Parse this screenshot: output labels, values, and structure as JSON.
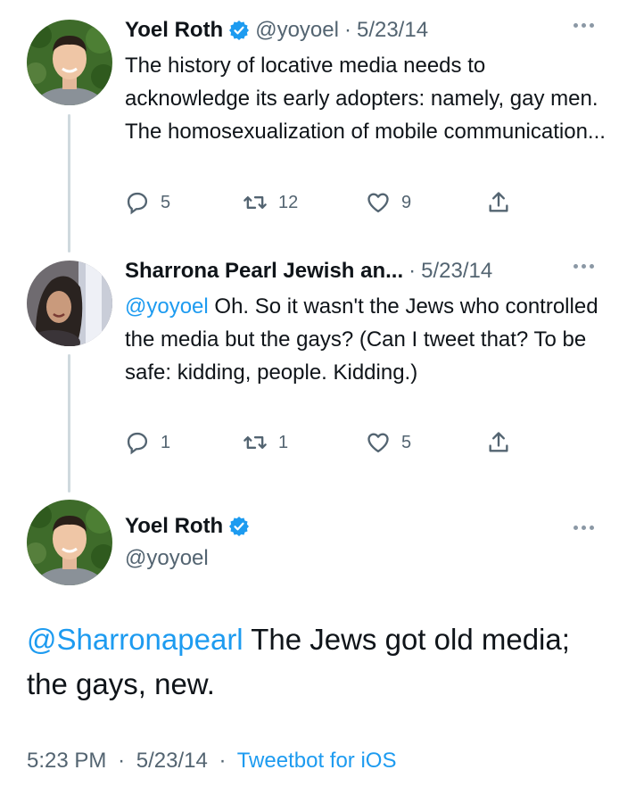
{
  "thread": [
    {
      "author": {
        "name": "Yoel Roth",
        "handle": "@yoyoel",
        "verified": true
      },
      "separator": "·",
      "date": "5/23/14",
      "text": "The history of locative media needs to acknowledge its early adopters: namely, gay men. The homosexualization of mobile communication...",
      "counts": {
        "replies": "5",
        "retweets": "12",
        "likes": "9"
      }
    },
    {
      "author": {
        "name": "Sharrona Pearl Jewish an...",
        "verified": false
      },
      "separator": "·",
      "date": "5/23/14",
      "mention": "@yoyoel",
      "text": " Oh.  So it wasn't the Jews who controlled the media but the gays?  (Can I tweet that?  To be safe: kidding, people. Kidding.)",
      "counts": {
        "replies": "1",
        "retweets": "1",
        "likes": "5"
      }
    }
  ],
  "main_tweet": {
    "author": {
      "name": "Yoel Roth",
      "handle": "@yoyoel",
      "verified": true
    },
    "mention": "@Sharronapearl",
    "text": " The Jews got old media; the gays, new.",
    "time": "5:23 PM",
    "separator": "·",
    "date": "5/23/14",
    "source": "Tweetbot for iOS"
  },
  "colors": {
    "accent": "#1d9bf0",
    "muted": "#536471",
    "text": "#0f1419",
    "line": "#cfd9de"
  },
  "icons": [
    "verified-badge-icon",
    "more-icon",
    "reply-icon",
    "retweet-icon",
    "like-icon",
    "share-icon"
  ]
}
